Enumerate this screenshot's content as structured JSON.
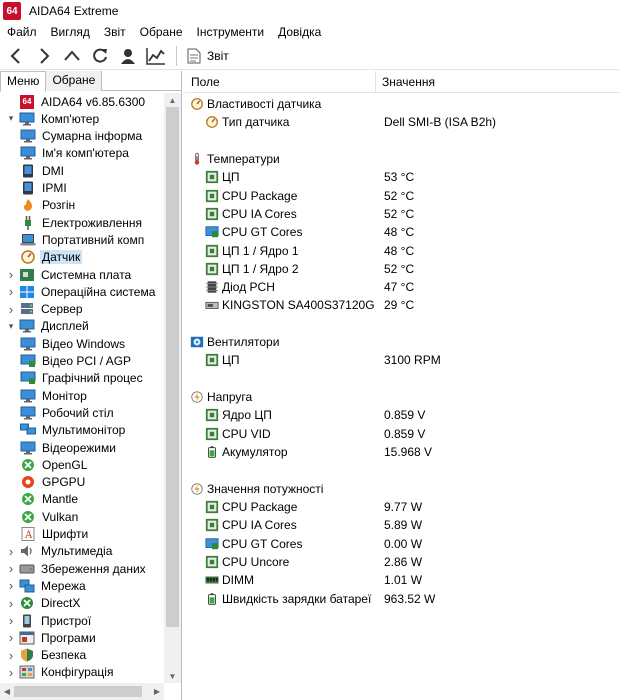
{
  "window": {
    "logo_text": "64",
    "title": "AIDA64 Extreme"
  },
  "menu": [
    "Файл",
    "Вигляд",
    "Звіт",
    "Обране",
    "Інструменти",
    "Довідка"
  ],
  "toolbar": {
    "icons": [
      "back-icon",
      "forward-icon",
      "up-icon",
      "refresh-icon",
      "user-icon",
      "chart-icon"
    ],
    "report_label": "Звіт"
  },
  "tabs": [
    "Меню",
    "Обране"
  ],
  "tree": [
    {
      "label": "AIDA64 v6.85.6300",
      "level": 0,
      "expander": "",
      "icon": "aida64-icon"
    },
    {
      "label": "Комп'ютер",
      "level": 0,
      "expander": "open",
      "icon": "computer-icon"
    },
    {
      "label": "Сумарна інформа",
      "level": 1,
      "expander": "",
      "icon": "summary-icon"
    },
    {
      "label": "Ім'я комп'ютера",
      "level": 1,
      "expander": "",
      "icon": "computer-name-icon"
    },
    {
      "label": "DMI",
      "level": 1,
      "expander": "",
      "icon": "dmi-icon"
    },
    {
      "label": "IPMI",
      "level": 1,
      "expander": "",
      "icon": "ipmi-icon"
    },
    {
      "label": "Розгін",
      "level": 1,
      "expander": "",
      "icon": "flame-icon"
    },
    {
      "label": "Електроживлення",
      "level": 1,
      "expander": "",
      "icon": "power-plug-icon"
    },
    {
      "label": "Портативний комп",
      "level": 1,
      "expander": "",
      "icon": "laptop-icon"
    },
    {
      "label": "Датчик",
      "level": 1,
      "expander": "",
      "icon": "sensor-gauge-icon",
      "selected": true
    },
    {
      "label": "Системна плата",
      "level": 0,
      "expander": "closed",
      "icon": "motherboard-icon"
    },
    {
      "label": "Операційна система",
      "level": 0,
      "expander": "closed",
      "icon": "windows-icon"
    },
    {
      "label": "Сервер",
      "level": 0,
      "expander": "closed",
      "icon": "server-icon"
    },
    {
      "label": "Дисплей",
      "level": 0,
      "expander": "open",
      "icon": "display-icon"
    },
    {
      "label": "Відео Windows",
      "level": 1,
      "expander": "",
      "icon": "video-windows-icon"
    },
    {
      "label": "Відео PCI / AGP",
      "level": 1,
      "expander": "",
      "icon": "video-pci-icon"
    },
    {
      "label": "Графічний процес",
      "level": 1,
      "expander": "",
      "icon": "gpu-icon"
    },
    {
      "label": "Монітор",
      "level": 1,
      "expander": "",
      "icon": "monitor-icon"
    },
    {
      "label": "Робочий стіл",
      "level": 1,
      "expander": "",
      "icon": "desktop-icon"
    },
    {
      "label": "Мультимонітор",
      "level": 1,
      "expander": "",
      "icon": "multimonitor-icon"
    },
    {
      "label": "Відеорежими",
      "level": 1,
      "expander": "",
      "icon": "video-modes-icon"
    },
    {
      "label": "OpenGL",
      "level": 1,
      "expander": "",
      "icon": "opengl-icon"
    },
    {
      "label": "GPGPU",
      "level": 1,
      "expander": "",
      "icon": "gpgpu-icon"
    },
    {
      "label": "Mantle",
      "level": 1,
      "expander": "",
      "icon": "mantle-icon"
    },
    {
      "label": "Vulkan",
      "level": 1,
      "expander": "",
      "icon": "vulkan-icon"
    },
    {
      "label": "Шрифти",
      "level": 1,
      "expander": "",
      "icon": "fonts-icon"
    },
    {
      "label": "Мультимедіа",
      "level": 0,
      "expander": "closed",
      "icon": "multimedia-icon"
    },
    {
      "label": "Збереження даних",
      "level": 0,
      "expander": "closed",
      "icon": "storage-icon"
    },
    {
      "label": "Мережа",
      "level": 0,
      "expander": "closed",
      "icon": "network-icon"
    },
    {
      "label": "DirectX",
      "level": 0,
      "expander": "closed",
      "icon": "directx-icon"
    },
    {
      "label": "Пристрої",
      "level": 0,
      "expander": "closed",
      "icon": "devices-icon"
    },
    {
      "label": "Програми",
      "level": 0,
      "expander": "closed",
      "icon": "programs-icon"
    },
    {
      "label": "Безпека",
      "level": 0,
      "expander": "closed",
      "icon": "security-icon"
    },
    {
      "label": "Конфігурація",
      "level": 0,
      "expander": "closed",
      "icon": "configuration-icon"
    }
  ],
  "columns": {
    "field": "Поле",
    "value": "Значення"
  },
  "sensor_rows": [
    {
      "kind": "group",
      "label": "Властивості датчика",
      "icon": "sensor-gauge-icon"
    },
    {
      "kind": "item",
      "label": "Тип датчика",
      "value": "Dell SMI-B  (ISA B2h)",
      "icon": "sensor-gauge-icon"
    },
    {
      "kind": "gap"
    },
    {
      "kind": "group",
      "label": "Температури",
      "icon": "thermometer-icon"
    },
    {
      "kind": "item",
      "label": "ЦП",
      "value": "53 °C",
      "icon": "cpu-chip-icon"
    },
    {
      "kind": "item",
      "label": "CPU Package",
      "value": "52 °C",
      "icon": "cpu-chip-icon"
    },
    {
      "kind": "item",
      "label": "CPU IA Cores",
      "value": "52 °C",
      "icon": "cpu-chip-icon"
    },
    {
      "kind": "item",
      "label": "CPU GT Cores",
      "value": "48 °C",
      "icon": "gpu-chip-icon"
    },
    {
      "kind": "item",
      "label": "ЦП 1 / Ядро 1",
      "value": "48 °C",
      "icon": "cpu-chip-icon"
    },
    {
      "kind": "item",
      "label": "ЦП 1 / Ядро 2",
      "value": "52 °C",
      "icon": "cpu-chip-icon"
    },
    {
      "kind": "item",
      "label": "Діод PCH",
      "value": "47 °C",
      "icon": "pch-chip-icon"
    },
    {
      "kind": "item",
      "label": "KINGSTON SA400S37120G",
      "value": "29 °C",
      "icon": "ssd-drive-icon"
    },
    {
      "kind": "gap"
    },
    {
      "kind": "group",
      "label": "Вентилятори",
      "icon": "fan-icon"
    },
    {
      "kind": "item",
      "label": "ЦП",
      "value": "3100 RPM",
      "icon": "cpu-chip-icon"
    },
    {
      "kind": "gap"
    },
    {
      "kind": "group",
      "label": "Напруга",
      "icon": "voltage-bolt-icon"
    },
    {
      "kind": "item",
      "label": "Ядро ЦП",
      "value": "0.859 V",
      "icon": "cpu-chip-icon"
    },
    {
      "kind": "item",
      "label": "CPU VID",
      "value": "0.859 V",
      "icon": "cpu-chip-icon"
    },
    {
      "kind": "item",
      "label": "Акумулятор",
      "value": "15.968 V",
      "icon": "battery-icon"
    },
    {
      "kind": "gap"
    },
    {
      "kind": "group",
      "label": "Значення потужності",
      "icon": "power-bolt-icon"
    },
    {
      "kind": "item",
      "label": "CPU Package",
      "value": "9.77 W",
      "icon": "cpu-chip-icon"
    },
    {
      "kind": "item",
      "label": "CPU IA Cores",
      "value": "5.89 W",
      "icon": "cpu-chip-icon"
    },
    {
      "kind": "item",
      "label": "CPU GT Cores",
      "value": "0.00 W",
      "icon": "gpu-chip-icon"
    },
    {
      "kind": "item",
      "label": "CPU Uncore",
      "value": "2.86 W",
      "icon": "cpu-chip-icon"
    },
    {
      "kind": "item",
      "label": "DIMM",
      "value": "1.01 W",
      "icon": "ram-icon"
    },
    {
      "kind": "item",
      "label": "Швидкість зарядки батареї",
      "value": "963.52 W",
      "icon": "battery-icon"
    }
  ]
}
